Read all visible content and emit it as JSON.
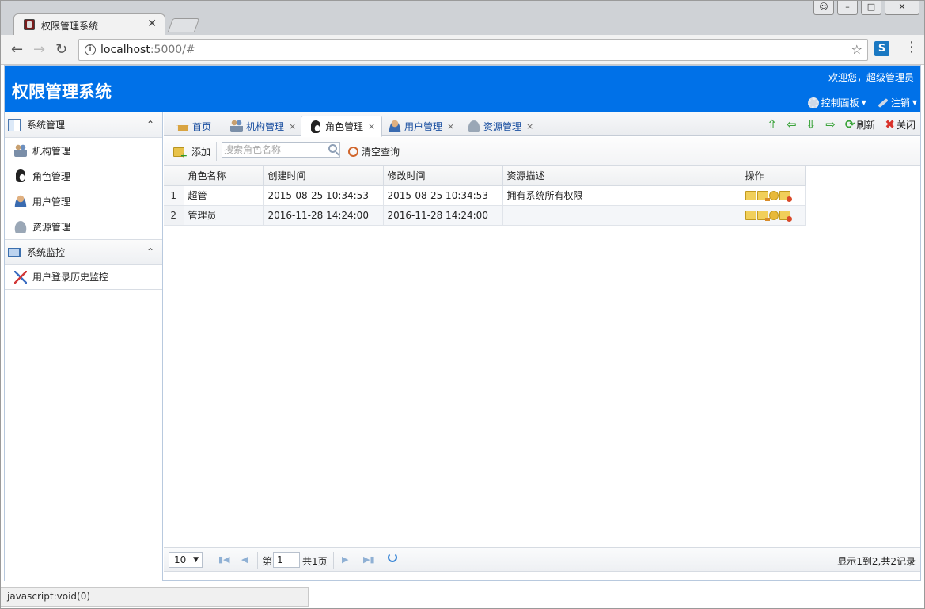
{
  "browser": {
    "tab_title": "权限管理系统",
    "tab_close": "✕",
    "url_host": "localhost",
    "url_path": ":5000/#",
    "status_text": "javascript:void(0)",
    "ext_label": "S"
  },
  "header": {
    "title": "权限管理系统",
    "welcome": "欢迎您，超级管理员",
    "control_panel": "控制面板",
    "logout": "注销"
  },
  "sidebar": {
    "groups": [
      {
        "label": "系统管理",
        "items": [
          {
            "label": "机构管理",
            "icon": "org-icon"
          },
          {
            "label": "角色管理",
            "icon": "penguin-icon"
          },
          {
            "label": "用户管理",
            "icon": "user-icon"
          },
          {
            "label": "资源管理",
            "icon": "resource-icon"
          }
        ]
      },
      {
        "label": "系统监控",
        "items": [
          {
            "label": "用户登录历史监控",
            "icon": "chart-icon"
          }
        ]
      }
    ]
  },
  "tabs": [
    {
      "label": "首页",
      "closable": false
    },
    {
      "label": "机构管理",
      "closable": true
    },
    {
      "label": "角色管理",
      "closable": true,
      "active": true
    },
    {
      "label": "用户管理",
      "closable": true
    },
    {
      "label": "资源管理",
      "closable": true
    }
  ],
  "tab_tools": {
    "refresh": "刷新",
    "close": "关闭"
  },
  "grid_tools": {
    "add": "添加",
    "search_placeholder": "搜索角色名称",
    "clear": "清空查询"
  },
  "table": {
    "columns": [
      "角色名称",
      "创建时间",
      "修改时间",
      "资源描述",
      "操作"
    ],
    "rows": [
      {
        "num": "1",
        "name": "超管",
        "created": "2015-08-25 10:34:53",
        "modified": "2015-08-25 10:34:53",
        "desc": "拥有系统所有权限"
      },
      {
        "num": "2",
        "name": "管理员",
        "created": "2016-11-28 14:24:00",
        "modified": "2016-11-28 14:24:00",
        "desc": ""
      }
    ]
  },
  "pager": {
    "page_size": "10",
    "page_prefix": "第",
    "page_value": "1",
    "page_suffix": "共1页",
    "info": "显示1到2,共2记录"
  },
  "colors": {
    "header_bg": "#0071e8",
    "link": "#1a4fa0"
  }
}
